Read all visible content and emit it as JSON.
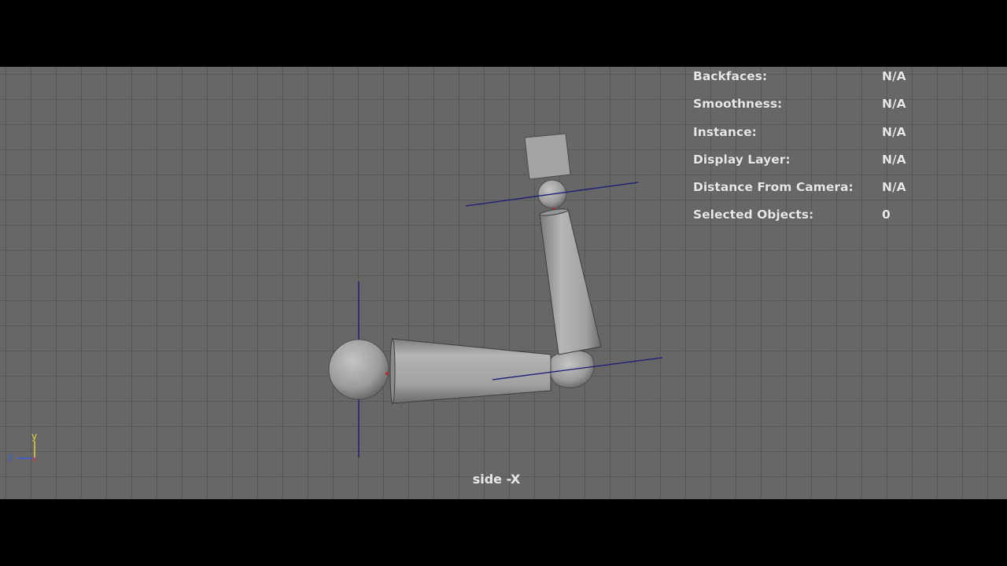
{
  "viewport": {
    "camera_name": "side -X",
    "colors": {
      "background": "#676767",
      "grid": "#585858",
      "mesh": "#a8a8a8",
      "joint_axis": "#1a1a7a"
    }
  },
  "hud": {
    "rows": [
      {
        "label": "Backfaces:",
        "value": "N/A"
      },
      {
        "label": "Smoothness:",
        "value": "N/A"
      },
      {
        "label": "Instance:",
        "value": "N/A"
      },
      {
        "label": "Display Layer:",
        "value": "N/A"
      },
      {
        "label": "Distance From Camera:",
        "value": "N/A"
      },
      {
        "label": "Selected Objects:",
        "value": "0"
      }
    ]
  },
  "axis_gizmo": {
    "y_label": "y",
    "z_label": "z",
    "y_color": "#e6d23a",
    "z_color": "#3a5ad8",
    "x_color": "#d83a2a"
  }
}
